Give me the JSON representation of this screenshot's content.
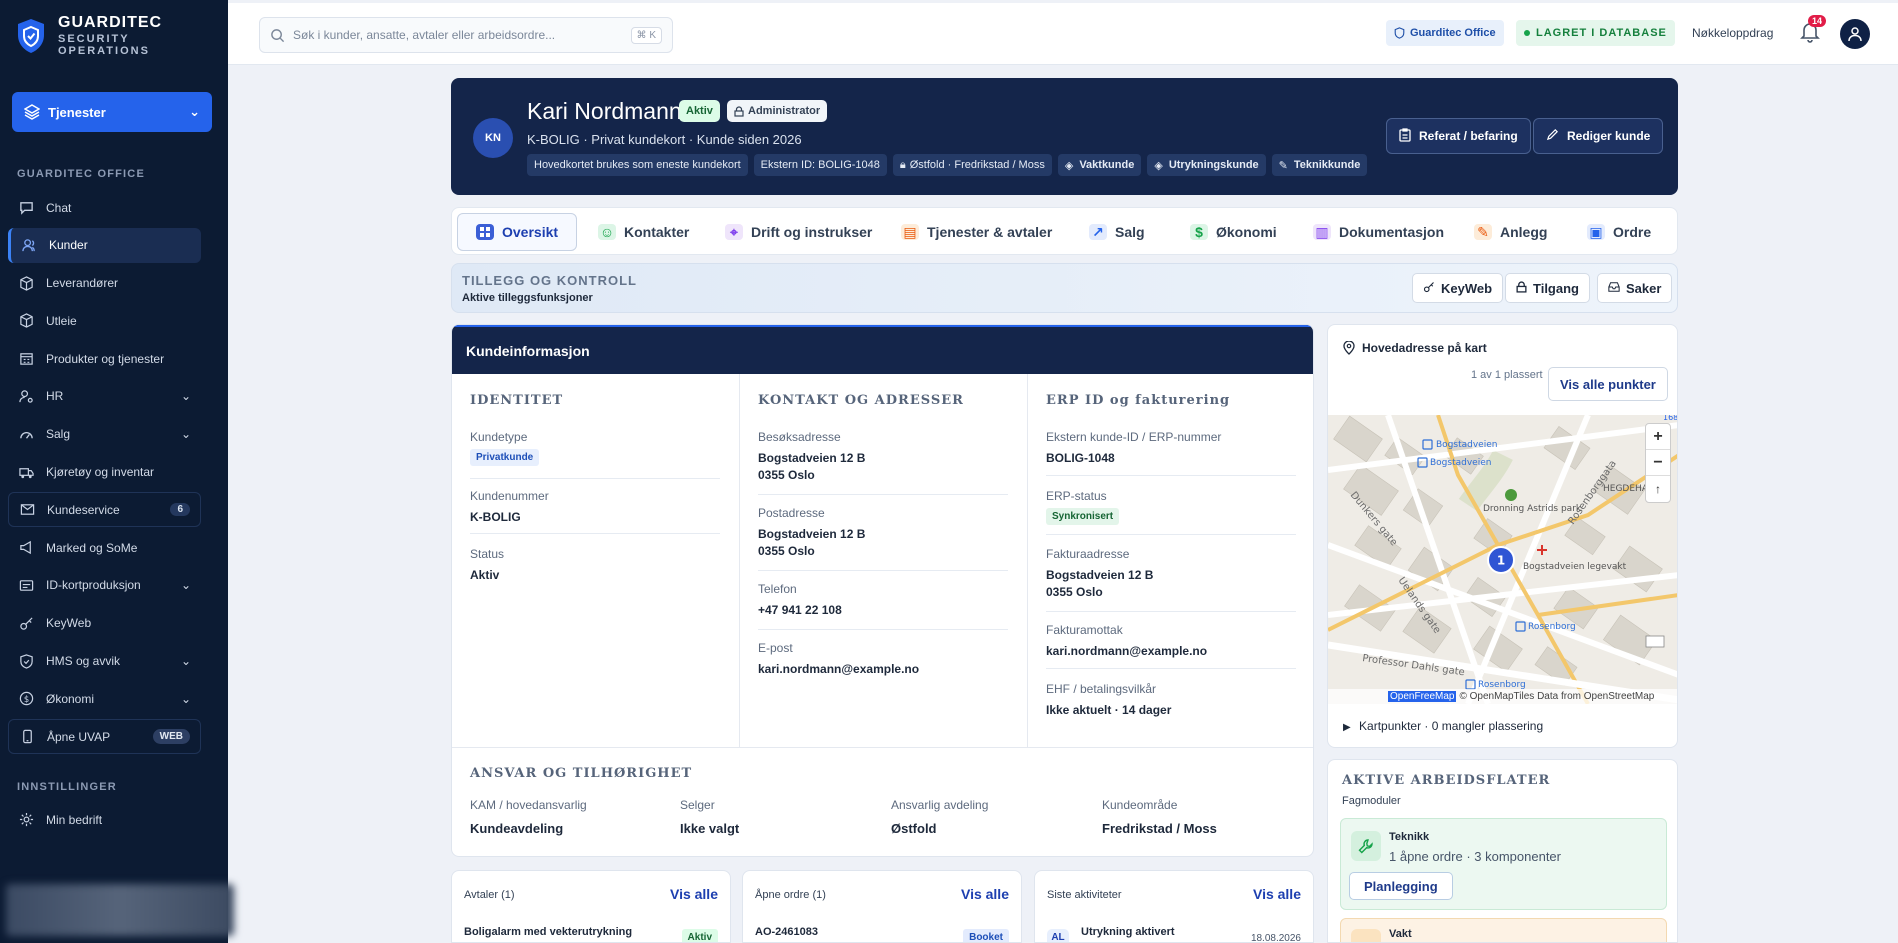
{
  "brand": {
    "name": "GUARDITEC",
    "line1": "SECURITY",
    "line2": "OPERATIONS"
  },
  "services_button": "Tjenester",
  "sidebar": {
    "section_office": "GUARDITEC OFFICE",
    "items": [
      {
        "label": "Chat",
        "icon": "chat-icon"
      },
      {
        "label": "Kunder",
        "icon": "users-icon",
        "active": true
      },
      {
        "label": "Leverandører",
        "icon": "box-icon"
      },
      {
        "label": "Utleie",
        "icon": "cube-icon"
      },
      {
        "label": "Produkter og tjenester",
        "icon": "building-icon"
      },
      {
        "label": "HR",
        "icon": "user-gear-icon",
        "expand": true
      },
      {
        "label": "Salg",
        "icon": "gauge-icon",
        "expand": true
      },
      {
        "label": "Kjøretøy og inventar",
        "icon": "truck-icon"
      },
      {
        "label": "Kundeservice",
        "icon": "mail-icon",
        "count": "6"
      },
      {
        "label": "Marked og SoMe",
        "icon": "megaphone-icon"
      },
      {
        "label": "ID-kortproduksjon",
        "icon": "id-card-icon",
        "expand": true
      },
      {
        "label": "KeyWeb",
        "icon": "key-icon"
      },
      {
        "label": "HMS og avvik",
        "icon": "shield-icon",
        "expand": true
      },
      {
        "label": "Økonomi",
        "icon": "dollar-icon",
        "expand": true
      },
      {
        "label": "Åpne UVAP",
        "icon": "phone-icon",
        "tag": "WEB"
      }
    ],
    "section_settings": "INNSTILLINGER",
    "settings_items": [
      {
        "label": "Min bedrift",
        "icon": "gear-icon"
      }
    ]
  },
  "topbar": {
    "search_placeholder": "Søk i kunder, ansatte, avtaler eller arbeidsordre...",
    "shortcut": "⌘ K",
    "office_badge": "Guarditec Office",
    "saved_badge": "LAGRET I DATABASE",
    "key_link": "Nøkkeloppdrag",
    "notifications": "14"
  },
  "customer": {
    "initials": "KN",
    "name": "Kari Nordmann",
    "status_pill": "Aktiv",
    "role_pill": "Administrator",
    "subtitle": "K-BOLIG · Privat kundekort · Kunde siden 2026",
    "chips": {
      "main_card": "Hovedkortet brukes som eneste kundekort",
      "external_id": "Ekstern ID: BOLIG-1048",
      "region": "Østfold · Fredrikstad / Moss",
      "vakt": "Vaktkunde",
      "utrykning": "Utrykningskunde",
      "teknikk": "Teknikkunde"
    },
    "btn_referat": "Referat / befaring",
    "btn_edit": "Rediger kunde"
  },
  "tabs": [
    {
      "label": "Oversikt",
      "icon": "grid-icon",
      "active": true
    },
    {
      "label": "Kontakter",
      "icon": "contacts-icon"
    },
    {
      "label": "Drift og instrukser",
      "icon": "pin-icon"
    },
    {
      "label": "Tjenester & avtaler",
      "icon": "doc-icon"
    },
    {
      "label": "Salg",
      "icon": "trend-icon"
    },
    {
      "label": "Økonomi",
      "icon": "coin-icon"
    },
    {
      "label": "Dokumentasjon",
      "icon": "folder-icon"
    },
    {
      "label": "Anlegg",
      "icon": "wrench-icon"
    },
    {
      "label": "Ordre",
      "icon": "clipboard-icon"
    }
  ],
  "tillegg": {
    "title": "TILLEGG OG KONTROLL",
    "subtitle": "Aktive tilleggsfunksjoner",
    "btn_keyweb": "KeyWeb",
    "btn_tilgang": "Tilgang",
    "btn_saker": "Saker"
  },
  "kundeinfo": {
    "title": "Kundeinformasjon",
    "identitet": {
      "heading": "IDENTITET",
      "kundetype_label": "Kundetype",
      "kundetype_value": "Privatkunde",
      "kundenummer_label": "Kundenummer",
      "kundenummer_value": "K-BOLIG",
      "status_label": "Status",
      "status_value": "Aktiv"
    },
    "kontakt": {
      "heading": "KONTAKT OG ADRESSER",
      "besok_label": "Besøksadresse",
      "besok_line1": "Bogstadveien 12 B",
      "besok_line2": "0355 Oslo",
      "post_label": "Postadresse",
      "post_line1": "Bogstadveien 12 B",
      "post_line2": "0355 Oslo",
      "telefon_label": "Telefon",
      "telefon_value": "+47 941 22 108",
      "epost_label": "E-post",
      "epost_value": "kari.nordmann@example.no"
    },
    "erp": {
      "heading": "ERP ID og fakturering",
      "ext_label": "Ekstern kunde-ID / ERP-nummer",
      "ext_value": "BOLIG-1048",
      "status_label": "ERP-status",
      "status_value": "Synkronisert",
      "faktura_label": "Fakturaadresse",
      "faktura_line1": "Bogstadveien 12 B",
      "faktura_line2": "0355 Oslo",
      "mottak_label": "Fakturamottak",
      "mottak_value": "kari.nordmann@example.no",
      "ehf_label": "EHF / betalingsvilkår",
      "ehf_value": "Ikke aktuelt · 14 dager"
    },
    "ansvar": {
      "heading": "ANSVAR OG TILHØRIGHET",
      "kam_label": "KAM / hovedansvarlig",
      "kam_value": "Kundeavdeling",
      "selger_label": "Selger",
      "selger_value": "Ikke valgt",
      "avd_label": "Ansvarlig avdeling",
      "avd_value": "Østfold",
      "omr_label": "Kundeområde",
      "omr_value": "Fredrikstad / Moss"
    }
  },
  "map": {
    "title": "Hovedadresse på kart",
    "count": "1 av 1 plassert",
    "btn": "Vis alle punkter",
    "marker": "1",
    "labels": {
      "street1": "Bogstadveien",
      "street2": "Bogstadveien",
      "street3": "Rosenborggata",
      "street4": "Dunkers gate",
      "street5": "Uelands gate",
      "park": "Dronning Astrids park",
      "legevakt": "Bogstadveien legevakt",
      "area": "HEGDEHA",
      "rosenborg1": "Rosenborg",
      "rosenborg2": "Rosenborg",
      "prof": "Professor Dahls gate",
      "route": "168"
    },
    "attribution_brand": "OpenFreeMap",
    "attribution_rest": "© OpenMapTiles Data from OpenStreetMap",
    "kartpunkter": "Kartpunkter · 0 mangler plassering"
  },
  "arbeidsflater": {
    "heading": "AKTIVE ARBEIDSFLATER",
    "subtitle": "Fagmoduler",
    "teknikk_title": "Teknikk",
    "teknikk_sub": "1 åpne ordre · 3 komponenter",
    "teknikk_btn": "Planlegging",
    "vakt_title": "Vakt"
  },
  "bottom": {
    "avtaler_title": "Avtaler (1)",
    "avtaler_link": "Vis alle",
    "avtaler_item": "Boligalarm med vekterutrykning",
    "avtaler_badge": "Aktiv",
    "ordre_title": "Åpne ordre (1)",
    "ordre_link": "Vis alle",
    "ordre_item": "AO-2461083",
    "ordre_badge": "Booket",
    "akt_title": "Siste aktiviteter",
    "akt_link": "Vis alle",
    "akt_icon": "AL",
    "akt_item": "Utrykning aktivert",
    "akt_date": "18.08.2026"
  },
  "colors": {
    "navy": "#14254a",
    "accent": "#2563eb",
    "success": "#16a34a",
    "danger": "#e11d48"
  }
}
